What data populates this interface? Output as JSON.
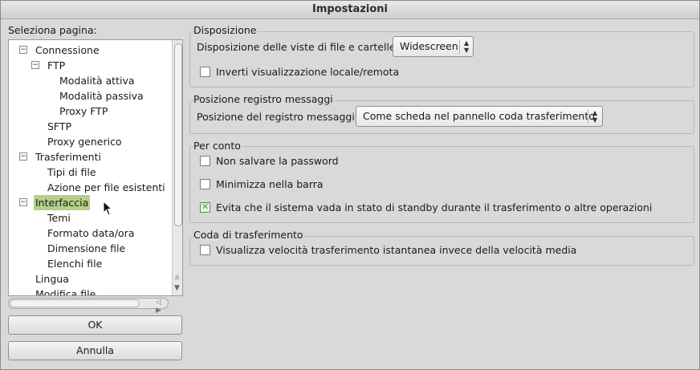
{
  "window": {
    "title": "Impostazioni"
  },
  "left": {
    "label": "Seleziona pagina:",
    "tree": [
      {
        "label": "Connessione",
        "expander": "−",
        "selected": false
      },
      {
        "label": "FTP",
        "expander": "−",
        "selected": false
      },
      {
        "label": "Modalità attiva",
        "selected": false
      },
      {
        "label": "Modalità passiva",
        "selected": false
      },
      {
        "label": "Proxy FTP",
        "selected": false
      },
      {
        "label": "SFTP",
        "selected": false
      },
      {
        "label": "Proxy generico",
        "selected": false
      },
      {
        "label": "Trasferimenti",
        "expander": "−",
        "selected": false
      },
      {
        "label": "Tipi di file",
        "selected": false
      },
      {
        "label": "Azione per file esistenti",
        "selected": false
      },
      {
        "label": "Interfaccia",
        "expander": "−",
        "selected": true
      },
      {
        "label": "Temi",
        "selected": false
      },
      {
        "label": "Formato data/ora",
        "selected": false
      },
      {
        "label": "Dimensione file",
        "selected": false
      },
      {
        "label": "Elenchi file",
        "selected": false
      },
      {
        "label": "Lingua",
        "selected": false
      },
      {
        "label": "Modifica file",
        "selected": false
      }
    ],
    "ok_label": "OK",
    "cancel_label": "Annulla"
  },
  "groups": {
    "layout": {
      "title": "Disposizione",
      "layout_label": "Disposizione delle viste di file e cartelle:",
      "layout_value": "Widescreen",
      "swap_label": "Inverti visualizzazione locale/remota",
      "swap_checked": false
    },
    "log": {
      "title": "Posizione registro messaggi",
      "position_label": "Posizione del registro messaggi:",
      "position_value": "Come scheda nel pannello coda trasferimento"
    },
    "behaviour": {
      "title": "Per conto",
      "no_password_label": "Non salvare la password",
      "no_password_checked": false,
      "minimize_label": "Minimizza nella barra",
      "minimize_checked": false,
      "standby_label": "Evita che il sistema vada in stato di standby durante il trasferimento o altre operazioni",
      "standby_checked": true
    },
    "queue": {
      "title": "Coda di trasferimento",
      "speed_label": "Visualizza velocità trasferimento istantanea invece della velocità media",
      "speed_checked": false
    }
  },
  "colors": {
    "selection": "#b5d08a",
    "check_mark": "#4a9a3a"
  }
}
